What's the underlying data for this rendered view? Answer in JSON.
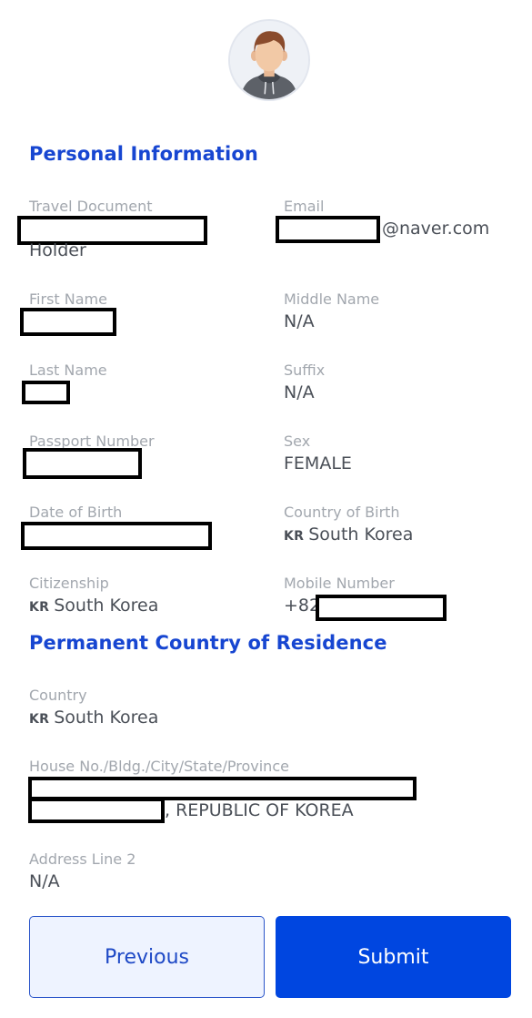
{
  "avatar": {
    "icon": "user-avatar-icon"
  },
  "personal": {
    "title": "Personal Information",
    "travel_document": {
      "label": "Travel Document",
      "value_suffix": "Holder"
    },
    "email": {
      "label": "Email",
      "value_suffix": "@naver.com"
    },
    "first_name": {
      "label": "First Name"
    },
    "middle_name": {
      "label": "Middle Name",
      "value": "N/A"
    },
    "last_name": {
      "label": "Last Name"
    },
    "suffix": {
      "label": "Suffix",
      "value": "N/A"
    },
    "passport_number": {
      "label": "Passport Number"
    },
    "sex": {
      "label": "Sex",
      "value": "FEMALE"
    },
    "date_of_birth": {
      "label": "Date of Birth"
    },
    "country_of_birth": {
      "label": "Country of Birth",
      "code": "KR",
      "value": "South Korea"
    },
    "citizenship": {
      "label": "Citizenship",
      "code": "KR",
      "value": "South Korea"
    },
    "mobile_number": {
      "label": "Mobile Number",
      "prefix": "+82"
    }
  },
  "residence": {
    "title": "Permanent Country of Residence",
    "country": {
      "label": "Country",
      "code": "KR",
      "value": "South Korea"
    },
    "address1": {
      "label": "House No./Bldg./City/State/Province",
      "value_suffix": ", REPUBLIC OF KOREA"
    },
    "address2": {
      "label": "Address Line 2",
      "value": "N/A"
    }
  },
  "actions": {
    "previous_label": "Previous",
    "submit_label": "Submit"
  },
  "colors": {
    "accent": "#1746d1",
    "primary_button": "#0046e0",
    "label": "#a2a7ae",
    "value": "#4a4f57"
  }
}
